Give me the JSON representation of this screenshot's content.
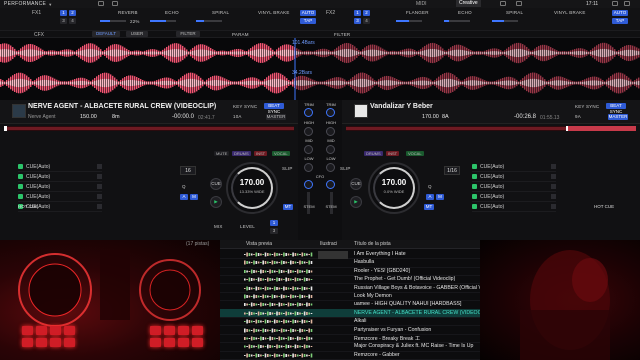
{
  "topbar": {
    "mode": "PERFORMANCE",
    "midi": "MIDI",
    "creative": "Creative",
    "clock": "17:11"
  },
  "fx": {
    "left": {
      "label": "FX1",
      "effects": [
        "REVERB",
        "ECHO",
        "SPIRAL"
      ],
      "extra": [
        "VINYL BRAKE",
        "AUTO",
        "TAP"
      ],
      "numbers": [
        "1",
        "2",
        "3",
        "4"
      ],
      "percent": "22%"
    },
    "right": {
      "label": "FX2",
      "effects": [
        "FLANGER",
        "ECHO",
        "SPIRAL"
      ],
      "extra": [
        "VINYL BRAKE",
        "AUTO",
        "TAP"
      ],
      "numbers": [
        "1",
        "2",
        "3",
        "4"
      ]
    }
  },
  "cfx": {
    "label": "CFX",
    "default": "DEFAULT",
    "user": "USER",
    "filter": "FILTER",
    "param": "PARAM",
    "extra": "FILTER"
  },
  "waveform": {
    "top_label": "101.4Bars",
    "bottom_label": "34.2Bars"
  },
  "deckA": {
    "title": "NERVE AGENT - ALBACETE RURAL CREW (VIDEOCLIP)",
    "artist": "Nerve Agent",
    "bpm": "150.00",
    "key": "8m",
    "time": "-00:00.0",
    "time2": "02:41.7",
    "keysync": "KEY SYNC",
    "beatsync": "BEAT SYNC",
    "key_display": "10A",
    "master": "MASTER",
    "tags": [
      "MUTE",
      "DRUMS",
      "INST",
      "VOCAL"
    ],
    "cues": [
      "CUE(Auto)",
      "CUE(Auto)",
      "CUE(Auto)",
      "CUE(Auto)",
      "CUE(Auto)"
    ],
    "jog_bpm": "170.00",
    "jog_pct": "13.33% WIDE",
    "beat_jump": "16",
    "hotcue": "HOT CUE",
    "cue_btn": "CUE",
    "slip": "SLIP",
    "q": "Q",
    "a": "A",
    "m": "M"
  },
  "deckB": {
    "title": "Vandalizar Y Beber",
    "bpm": "170.00",
    "key": "8A",
    "time": "-00:26.8",
    "time2": "01:55.13",
    "keysync": "KEY SYNC",
    "beatsync": "BEAT SYNC",
    "key_display": "9A",
    "master": "MASTER",
    "tags": [
      "DRUMS",
      "INST",
      "VOCAL"
    ],
    "cues": [
      "CUE(Auto)",
      "CUE(Auto)",
      "CUE(Auto)",
      "CUE(Auto)",
      "CUE(Auto)"
    ],
    "jog_bpm": "170.00",
    "jog_pct": "0.0% WIDE",
    "beat_jump": "1/16",
    "hotcue": "HOT CUE",
    "cue_btn": "CUE",
    "slip": "SLIP",
    "q": "Q",
    "a": "A",
    "m": "M"
  },
  "mixer": {
    "trim": "TRIM",
    "high": "HIGH",
    "mid": "MID",
    "low": "LOW",
    "cfo": "CFO",
    "stem": "STEM",
    "mix": "MIX",
    "level": "LEVEL",
    "nums": [
      "1",
      "2",
      "3",
      "4"
    ]
  },
  "browser": {
    "folder": "(17 pistas)",
    "headers": {
      "preview": "Vista previa",
      "art": "Ilustraci",
      "title": "Título de la pista"
    },
    "tracks": [
      "I Am Everything I Hate",
      "Hasbulla",
      "Rooler - YES! [GBD240]",
      "The Prophet - Get Dumb! (Official Videoclip)",
      "Russian Village Boys & Botavoice - GABBER (Official Video)",
      "Look My Demon",
      "uamee - HIGH QUALITY NAHUI [HARDBASS]",
      "NERVE AGENT - ALBACETE RURAL CREW (VIDEOCLIP)",
      "Alkali",
      "Partyraiser vs Furyan - Confusion",
      "Remzcore - Breaky Break 工",
      "Major Conspiracy & Juliex ft. MC Raise - Time Is Up",
      "Remzcore - Gabber"
    ],
    "selected_index": 7
  }
}
